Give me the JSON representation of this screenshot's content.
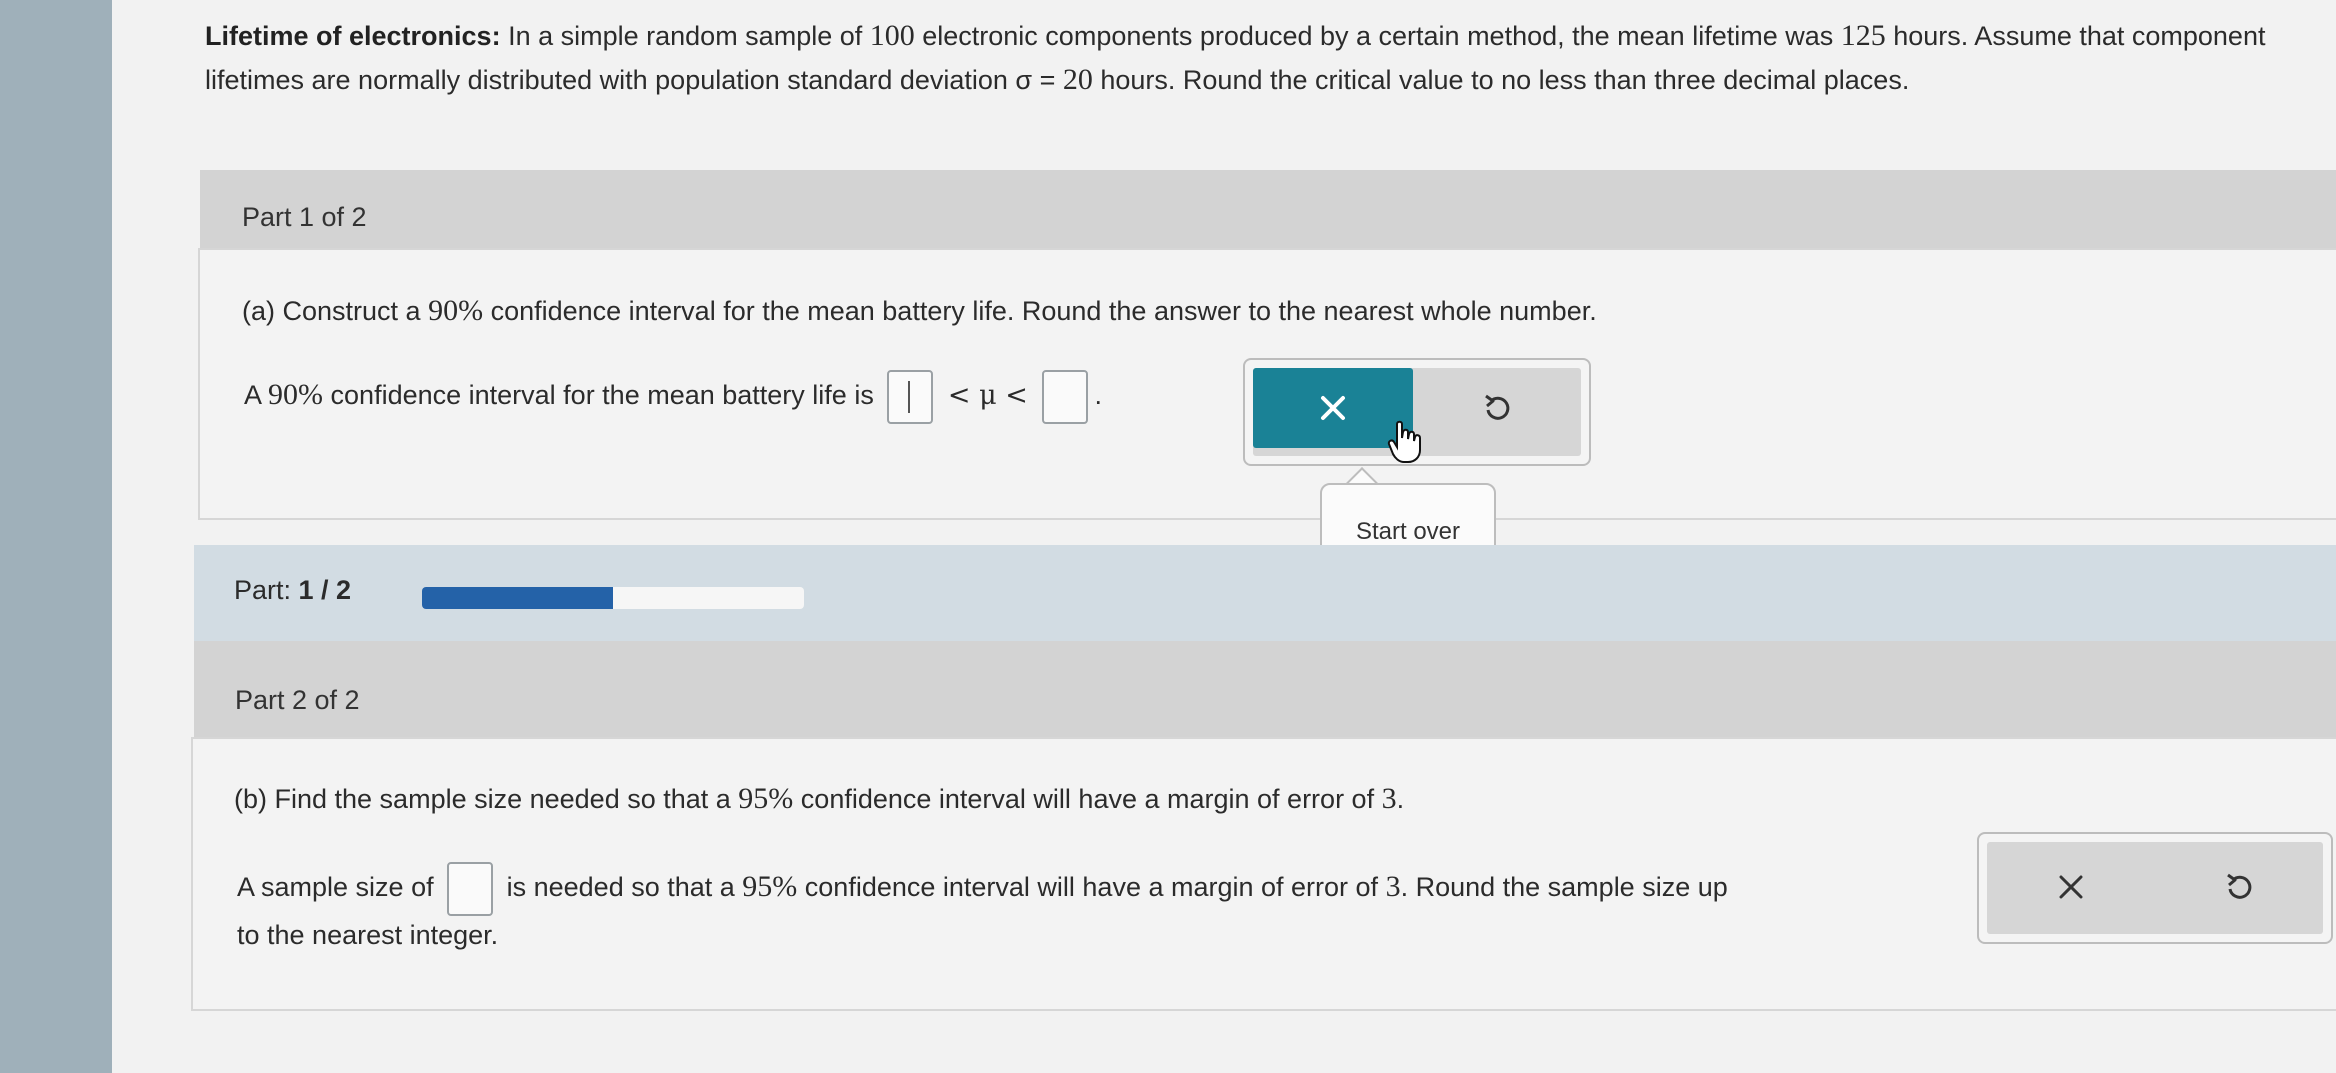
{
  "problem": {
    "title": "Lifetime of electronics:",
    "text_1": " In a simple random sample of ",
    "n": "100",
    "text_2": " electronic components produced by a certain method, the mean lifetime was ",
    "mean": "125",
    "text_3": " hours. Assume that component lifetimes are normally distributed with population standard deviation σ = ",
    "sigma": "20",
    "text_4": " hours. Round the critical value to no less than three decimal places."
  },
  "part1": {
    "header": "Part 1 of 2",
    "question_prefix": "(a) Construct a ",
    "question_pct": "90%",
    "question_suffix": " confidence interval for the mean battery life. Round the answer to the nearest whole number.",
    "answer_prefix": "A ",
    "answer_pct": "90%",
    "answer_mid": " confidence interval for the mean battery life is ",
    "symbol": " < μ < ",
    "answer_end": "."
  },
  "tooltip": {
    "label": "Start over"
  },
  "progress": {
    "label": "Part: ",
    "value": "1 / 2",
    "fraction": 0.5
  },
  "part2": {
    "header": "Part 2 of 2",
    "question_prefix": "(b) Find the sample size needed so that a ",
    "question_pct": "95%",
    "question_mid": " confidence interval will have a margin of error of ",
    "question_moe": "3",
    "question_end": ".",
    "answer_prefix": "A sample size of ",
    "answer_mid": " is needed so that a ",
    "answer_pct": "95%",
    "answer_mid2": " confidence interval will have a margin of error of ",
    "answer_moe": "3",
    "answer_suffix": ". Round the sample size up",
    "answer_line2": "to the nearest integer."
  },
  "colors": {
    "accent": "#1a8296",
    "progress": "#2462a8"
  },
  "icons": {
    "clear": "x-icon",
    "undo": "undo-icon"
  }
}
